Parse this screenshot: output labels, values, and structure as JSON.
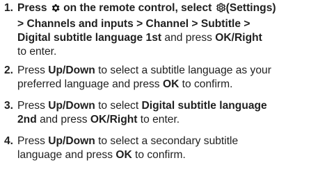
{
  "steps": [
    {
      "number": "1.",
      "line1": {
        "t1": "Press ",
        "icon": "gear-icon",
        "t2": " on the remote control, select ",
        "icon2": "settings-icon",
        "b1": "(Settings)"
      },
      "line2": {
        "b": "> Channels and inputs > Channel > Subtitle >"
      },
      "line3": {
        "b": "Digital subtitle language 1st",
        "t": " and press ",
        "b2": "OK/Right"
      },
      "line4": {
        "t": "to enter."
      }
    },
    {
      "number": "2.",
      "line1": {
        "t1": "Press ",
        "b1": "Up/Down",
        "t2": " to select a subtitle language as your"
      },
      "line2": {
        "t1": "preferred language and press ",
        "b1": "OK",
        "t2": " to confirm."
      }
    },
    {
      "number": "3.",
      "line1": {
        "t1": "Press ",
        "b1": "Up/Down",
        "t2": " to select ",
        "b2": "Digital subtitle language"
      },
      "line2": {
        "b1": "2nd",
        "t1": " and press ",
        "b2": "OK/Right",
        "t2": " to enter."
      }
    },
    {
      "number": "4.",
      "line1": {
        "t1": "Press ",
        "b1": "Up/Down",
        "t2": " to select a secondary subtitle"
      },
      "line2": {
        "t1": "language and press ",
        "b1": "OK",
        "t2": " to confirm."
      }
    }
  ]
}
